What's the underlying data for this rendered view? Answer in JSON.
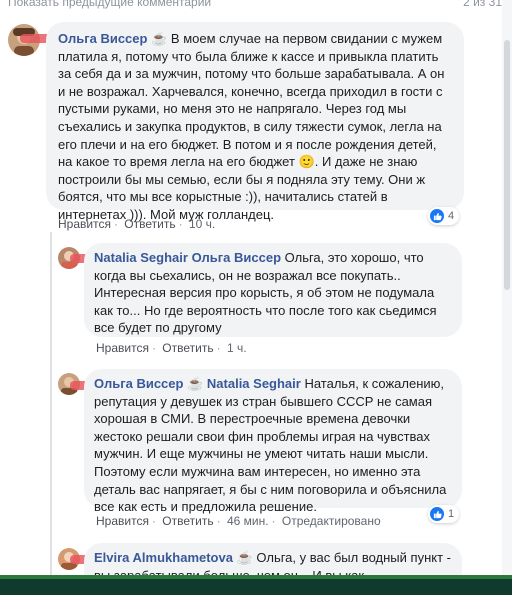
{
  "top": {
    "prev_comments": "Показать предыдущие комментарии",
    "counter": "2 из 31"
  },
  "comments": [
    {
      "author": "Ольга Виссер",
      "body": "В моем случае на первом свидании с мужем платила я, потому что была ближе к кассе и привыкла платить за себя да и за мужчин, потому что больше зарабатывала. А он и не возражал. Харчевался, конечно, всегда приходил в гости с пустыми руками, но меня это не напрягало. Через год мы съехались и закупка продуктов, в силу тяжести сумок, легла на его плечи и на его бюджет. В потом и я после рождения детей, на какое то время легла на его бюджет 🙂. И даже не знаю построили бы мы семью, если бы я подняла эту тему. Они ж боятся, что мы все корыстные :)), начитались статей в интернетах ))). Мой муж голландец.",
      "like": "Нравится",
      "reply": "Ответить",
      "time": "10 ч.",
      "reactions": "4"
    },
    {
      "author": "Natalia Seghair",
      "mention": "Ольга Виссер",
      "body": "Ольга, это хорошо, что когда вы сьехались, он не возражал все покупать.. Интересная версия про корысть, я об этом не подумала как то... Но где вероятность что после того как сьедимся все будет по другому",
      "like": "Нравится",
      "reply": "Ответить",
      "time": "1 ч."
    },
    {
      "author": "Ольга Виссер",
      "mention": "Natalia Seghair",
      "body": "Наталья, к сожалению, репутация у девушек из стран бывшего СССР не самая хорошая в СМИ. В перестроечные времена девочки жестоко решали свои фин проблемы играя на чувствах мужчин. И еще мужчины не умеют читать наши мысли. Поэтому если мужчина вам интересен, но именно эта деталь вас напрягает, я бы с ним поговорила и объяснила все как есть и предложила решение.",
      "like": "Нравится",
      "reply": "Ответить",
      "time": "46 мин.",
      "edited": "Отредактировано",
      "reactions": "1"
    },
    {
      "author": "Elvira Almukhametova",
      "body": "Ольга, у вас был водный пункт - вы зарабатывали больше, чем он... И вы как"
    }
  ],
  "colors": {
    "link": "#385898",
    "bubble": "#f2f3f5",
    "redaction": "#e8545b",
    "like_blue": "#1877f2"
  },
  "icons": [
    "thumbs-up-icon",
    "coffee-cup-icon"
  ]
}
